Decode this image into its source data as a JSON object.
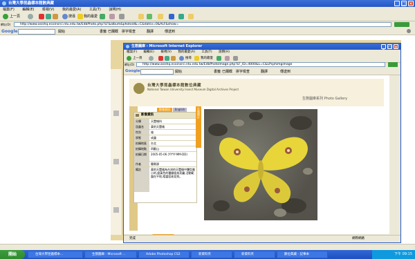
{
  "outer": {
    "title": "台灣大學昆蟲標本館數典藏",
    "menu": [
      "檔案(F)",
      "編輯(E)",
      "檢視(V)",
      "我的最愛(A)",
      "工具(T)",
      "說明(H)"
    ],
    "toolbar": {
      "back": "上一頁",
      "search": "搜尋",
      "favorites": "我的最愛"
    },
    "address_label": "網址(D)",
    "address": "http://www.asishq.ecoinsrci.ntu.edu.tw/EdbPhoto.php?LF&album&photoid&=C&datsv=0&ALF&show=",
    "google_label": "Google",
    "google_buttons": [
      "開始",
      "書籤",
      "已攔截",
      "拼字檢查",
      "翻譯",
      "傳送到"
    ]
  },
  "inner": {
    "title": "生態圖庫 - Microsoft Internet Explorer",
    "menu": [
      "檔案(F)",
      "編輯(E)",
      "檢視(V)",
      "我的最愛(A)",
      "工具(T)",
      "說明(H)"
    ],
    "toolbar": {
      "back": "上一頁",
      "search": "搜尋",
      "favorites": "我的最愛"
    },
    "address_label": "網址(D)",
    "address": "http://www.asishq.ecoinsrci.ntu.edu.tw/EdbPhotoImage.php?LF_ID=4000&L=C&LPcphimgimage",
    "google_label": "Google",
    "google_buttons": [
      "開始",
      "書籤",
      "已攔截",
      "拼字檢查",
      "翻譯",
      "傳送到"
    ],
    "status_left": "完成",
    "status_right": "網際網路"
  },
  "page": {
    "brand_cn": "台灣大學昆蟲標本館數位典藏",
    "brand_en": "National Taiwan University Insect Museum Digital Archives Project",
    "gallery_title": "生態圖庫系列  Photo Gallery",
    "tab_chinese": "影像資訊",
    "tab_english": "English",
    "info_title": "影像資訊",
    "rows": [
      {
        "label": "分類",
        "value": "天蠶蛾科"
      },
      {
        "label": "昆蟲名",
        "value": "黃豹天蠶蛾"
      },
      {
        "label": "性別",
        "value": "雄"
      },
      {
        "label": "狀態",
        "value": "成蟲"
      },
      {
        "label": "拍攝地區",
        "value": "台北"
      },
      {
        "label": "拍攝地點",
        "value": "四獸山"
      },
      {
        "label": "拍攝日期",
        "value": "2005-05-06 (YYYY-MM-DD)"
      },
      {
        "label": "作者",
        "value": "簡朝源"
      },
      {
        "label": "備註",
        "value": "黃豹天蠶蛾為台灣的天蠶蛾中體型最小的,翅黃色的種類極為亮麗,活動範圍在平地,相當容易見到。"
      }
    ],
    "close_button": "關閉視窗",
    "side_tab": "生態照片"
  },
  "taskbar": {
    "start": "開始",
    "tasks": [
      "台灣大學昆蟲標本...",
      "生態圖庫 - Microsoft ...",
      "Adobe Photoshop CS2",
      "新資料夾",
      "新資料夾",
      "數位典藏 - 記事本"
    ],
    "clock": "下午 09:15"
  },
  "colors": {
    "accent": "#f0a020",
    "title_bar": "#2457c5",
    "header_bg": "#f7f0dc"
  }
}
